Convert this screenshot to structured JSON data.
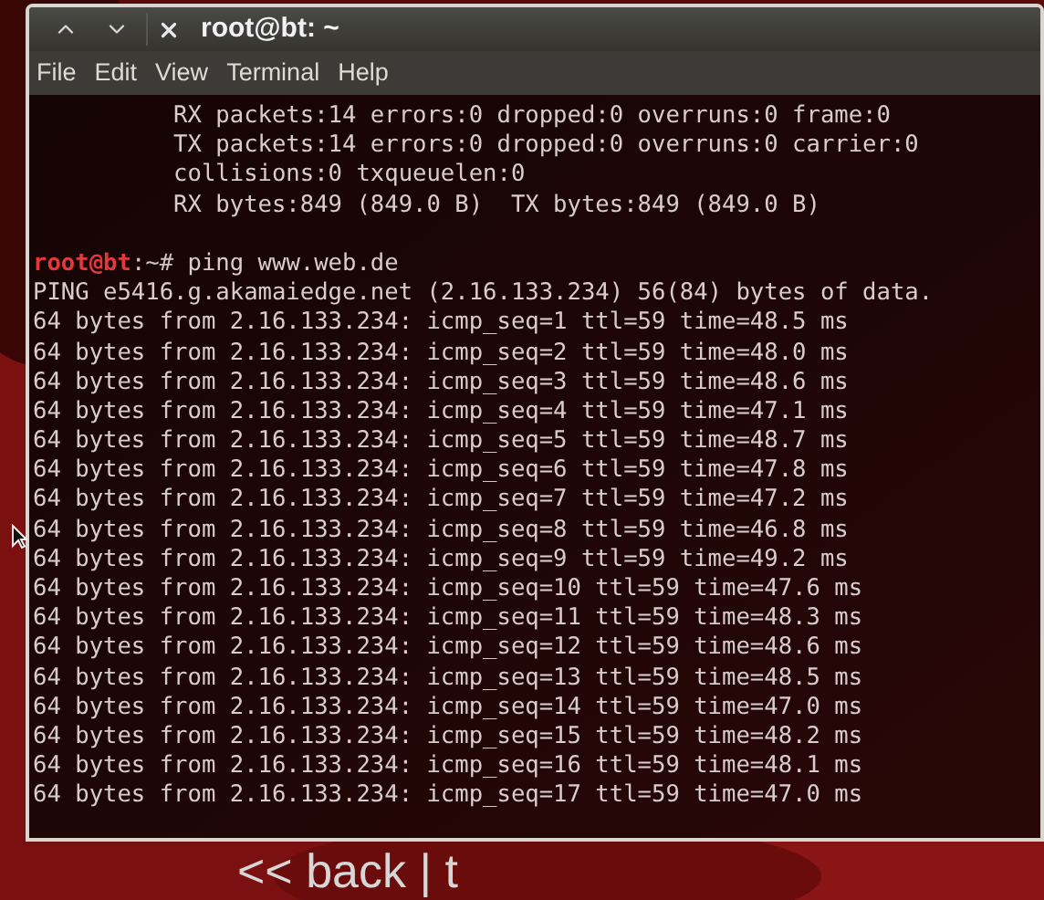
{
  "window": {
    "title": "root@bt: ~"
  },
  "menu": [
    "File",
    "Edit",
    "View",
    "Terminal",
    "Help"
  ],
  "terminal": {
    "lines": [
      {
        "kind": "output",
        "text": "          RX packets:14 errors:0 dropped:0 overruns:0 frame:0"
      },
      {
        "kind": "output",
        "text": "          TX packets:14 errors:0 dropped:0 overruns:0 carrier:0"
      },
      {
        "kind": "output",
        "text": "          collisions:0 txqueuelen:0"
      },
      {
        "kind": "output",
        "text": "          RX bytes:849 (849.0 B)  TX bytes:849 (849.0 B)"
      },
      {
        "kind": "blank"
      },
      {
        "kind": "prompt",
        "user": "root@bt",
        "path": ":~# ",
        "command": "ping www.web.de"
      },
      {
        "kind": "output",
        "text": "PING e5416.g.akamaiedge.net (2.16.133.234) 56(84) bytes of data."
      },
      {
        "kind": "output",
        "text": "64 bytes from 2.16.133.234: icmp_seq=1 ttl=59 time=48.5 ms"
      },
      {
        "kind": "output",
        "text": "64 bytes from 2.16.133.234: icmp_seq=2 ttl=59 time=48.0 ms"
      },
      {
        "kind": "output",
        "text": "64 bytes from 2.16.133.234: icmp_seq=3 ttl=59 time=48.6 ms"
      },
      {
        "kind": "output",
        "text": "64 bytes from 2.16.133.234: icmp_seq=4 ttl=59 time=47.1 ms"
      },
      {
        "kind": "output",
        "text": "64 bytes from 2.16.133.234: icmp_seq=5 ttl=59 time=48.7 ms"
      },
      {
        "kind": "output",
        "text": "64 bytes from 2.16.133.234: icmp_seq=6 ttl=59 time=47.8 ms"
      },
      {
        "kind": "output",
        "text": "64 bytes from 2.16.133.234: icmp_seq=7 ttl=59 time=47.2 ms"
      },
      {
        "kind": "output",
        "text": "64 bytes from 2.16.133.234: icmp_seq=8 ttl=59 time=46.8 ms"
      },
      {
        "kind": "output",
        "text": "64 bytes from 2.16.133.234: icmp_seq=9 ttl=59 time=49.2 ms"
      },
      {
        "kind": "output",
        "text": "64 bytes from 2.16.133.234: icmp_seq=10 ttl=59 time=47.6 ms"
      },
      {
        "kind": "output",
        "text": "64 bytes from 2.16.133.234: icmp_seq=11 ttl=59 time=48.3 ms"
      },
      {
        "kind": "output",
        "text": "64 bytes from 2.16.133.234: icmp_seq=12 ttl=59 time=48.6 ms"
      },
      {
        "kind": "output",
        "text": "64 bytes from 2.16.133.234: icmp_seq=13 ttl=59 time=48.5 ms"
      },
      {
        "kind": "output",
        "text": "64 bytes from 2.16.133.234: icmp_seq=14 ttl=59 time=47.0 ms"
      },
      {
        "kind": "output",
        "text": "64 bytes from 2.16.133.234: icmp_seq=15 ttl=59 time=48.2 ms"
      },
      {
        "kind": "output",
        "text": "64 bytes from 2.16.133.234: icmp_seq=16 ttl=59 time=48.1 ms"
      },
      {
        "kind": "output",
        "text": "64 bytes from 2.16.133.234: icmp_seq=17 ttl=59 time=47.0 ms"
      }
    ]
  },
  "wallpaper_logo": "<< back | t"
}
